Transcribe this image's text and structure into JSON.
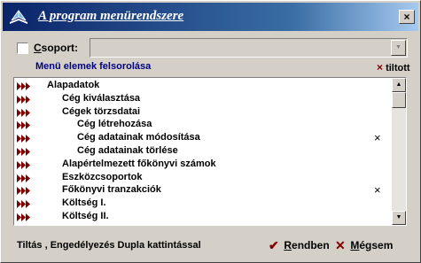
{
  "window": {
    "title": "A program menürendszere",
    "close_glyph": "×"
  },
  "group": {
    "checkbox_checked": false,
    "label_first": "C",
    "label_rest": "soport:",
    "combo_value": ""
  },
  "list": {
    "header": "Menü elemek felsorolása",
    "tilt_header": "tiltott",
    "tilt_glyph": "×",
    "items": [
      {
        "label": "Alapadatok",
        "level": 0,
        "blocked": false
      },
      {
        "label": "Cég kiválasztása",
        "level": 1,
        "blocked": false
      },
      {
        "label": "Cégek törzsdatai",
        "level": 1,
        "blocked": false
      },
      {
        "label": "Cég létrehozása",
        "level": 2,
        "blocked": false
      },
      {
        "label": "Cég adatainak módosítása",
        "level": 2,
        "blocked": true
      },
      {
        "label": "Cég adatainak törlése",
        "level": 2,
        "blocked": false
      },
      {
        "label": "Alapértelmezett főkönyvi számok",
        "level": 1,
        "blocked": false
      },
      {
        "label": "Eszközcsoportok",
        "level": 1,
        "blocked": false
      },
      {
        "label": "Főkönyvi tranzakciók",
        "level": 1,
        "blocked": true
      },
      {
        "label": "Költség I.",
        "level": 1,
        "blocked": false
      },
      {
        "label": "Költség II.",
        "level": 1,
        "blocked": false
      }
    ]
  },
  "footer": {
    "hint": "Tiltás , Engedélyezés Dupla kattintással",
    "ok_first": "R",
    "ok_rest": "endben",
    "cancel_first": "M",
    "cancel_rest": "égsem",
    "ok_glyph": "✔",
    "cancel_glyph": "✕"
  },
  "icons": {
    "title": "book-icon",
    "row_marker": "triple-arrow-icon",
    "ok": "checkmark-icon",
    "cancel": "x-icon"
  },
  "colors": {
    "title_gradient_start": "#0a246a",
    "title_gradient_end": "#a6caf0",
    "accent_dark_red": "#800000",
    "list_header": "#000080"
  }
}
